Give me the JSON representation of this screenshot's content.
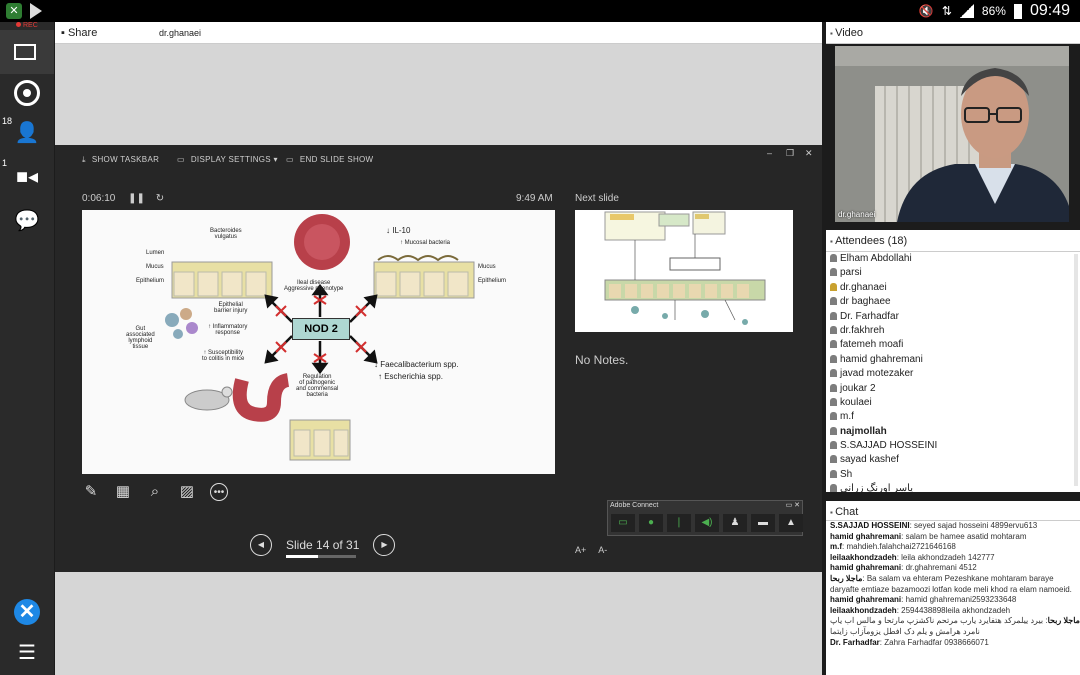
{
  "status_bar": {
    "time": "09:49",
    "battery": "86%"
  },
  "rail": {
    "rec_label": "REC",
    "attendee_count": "18",
    "video_count": "1"
  },
  "share_pod": {
    "title": "Share",
    "presenter": "dr.ghanaei"
  },
  "presenter_toolbar": {
    "taskbar_label": "SHOW TASKBAR",
    "display_settings_label": "DISPLAY SETTINGS ▾",
    "end_slideshow_label": "END SLIDE SHOW"
  },
  "presenter_view": {
    "timer": "0:06:10",
    "clock": "9:49 AM",
    "next_slide_label": "Next slide",
    "notes": "No Notes.",
    "slide_counter": "Slide 14 of 31",
    "progress": 0.45,
    "font_larger": "A+",
    "font_smaller": "A-"
  },
  "slide": {
    "center_label": "NOD 2",
    "labels": {
      "bacteroides": "Bacteroides\nvulgatus",
      "lumen": "Lumen",
      "mucus_left": "Mucus",
      "epithelium_left": "Epithelium",
      "ileal": "Ileal disease\nAggressive phenotype",
      "il10": "↓ IL-10",
      "mucosal": "↑ Mucosal bacteria",
      "mucus_right": "Mucus",
      "epithelium_right": "Epithelium",
      "barrier": "Epithelial\nbarrier injury",
      "inflammatory": "↑ Inflammatory\nresponse",
      "gut": "Gut\nassociated\nlymphoid\ntissue",
      "susceptibility": "↑ Susceptibility\nto colitis in mice",
      "faecali": "↓ Faecalibacterium spp.",
      "escherichia": "↑ Escherichia spp.",
      "regulation": "Regulation\nof pathogenic\nand commensal\nbacteria"
    }
  },
  "adobe_connect": {
    "title": "Adobe Connect"
  },
  "video_pod": {
    "title": "Video",
    "name": "dr.ghanaei"
  },
  "attendees_pod": {
    "title": "Attendees (18)",
    "items": [
      {
        "name": "Elham Abdollahi",
        "role": "participant"
      },
      {
        "name": "parsi",
        "role": "participant"
      },
      {
        "name": "dr.ghanaei",
        "role": "host"
      },
      {
        "name": "dr baghaee",
        "role": "participant"
      },
      {
        "name": "Dr. Farhadfar",
        "role": "participant"
      },
      {
        "name": "dr.fakhreh",
        "role": "participant"
      },
      {
        "name": "fatemeh moafi",
        "role": "participant"
      },
      {
        "name": "hamid ghahremani",
        "role": "participant"
      },
      {
        "name": "javad motezaker",
        "role": "participant"
      },
      {
        "name": "joukar 2",
        "role": "participant"
      },
      {
        "name": "koulaei",
        "role": "participant"
      },
      {
        "name": "m.f",
        "role": "participant"
      },
      {
        "name": "najmollah",
        "role": "participant",
        "bold": true
      },
      {
        "name": "S.SAJJAD HOSSEINI",
        "role": "participant"
      },
      {
        "name": "sayad kashef",
        "role": "participant"
      },
      {
        "name": "Sh",
        "role": "participant"
      },
      {
        "name": "یاسر اورنگ زرانی",
        "role": "participant"
      }
    ]
  },
  "chat_pod": {
    "title": "Chat",
    "messages": [
      {
        "sender": "S.SAJJAD HOSSEINI",
        "text": "seyed sajad hosseini 4899ervu613"
      },
      {
        "sender": "hamid ghahremani",
        "text": "salam be hamee asatid mohtaram"
      },
      {
        "sender": "m.f",
        "text": "mahdieh.falahchai2721646168"
      },
      {
        "sender": "leilaakhondzadeh",
        "text": "leila akhondzadeh 142777"
      },
      {
        "sender": "hamid ghahremani",
        "text": "dr.ghahremani 4512"
      },
      {
        "sender": "ماجلا ربحا",
        "text": "Ba salam va ehteram Pezeshkane mohtaram baraye daryafte emtiaze bazamoozi lotfan kode meli khod ra elam namoeid."
      },
      {
        "sender": "hamid ghahremani",
        "text": "hamid ghahremani2593233648"
      },
      {
        "sender": "leilaakhondzadeh",
        "text": "2594438898leila akhondzadeh"
      },
      {
        "sender": "ماجلا ربحا",
        "text": "بیرد ییلمرکد هتفایرد یارب مرتحم ناکشزپ مارتحا و مالس اب یاپ نامرد هرامش و یلم دک افطل یزومآزاب زایتما"
      },
      {
        "sender": "Dr. Farhadfar",
        "text": "Zahra Farhadfar 0938666071"
      }
    ]
  }
}
